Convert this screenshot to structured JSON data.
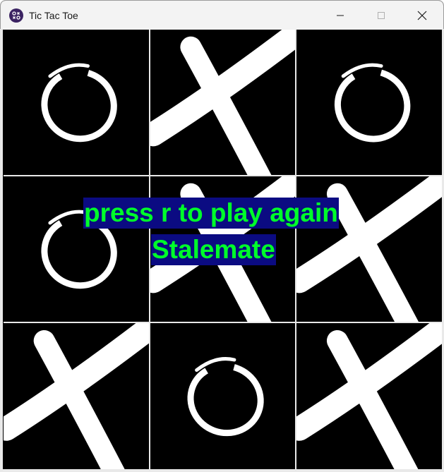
{
  "window": {
    "title": "Tic Tac Toe",
    "icon": "app-icon",
    "controls": [
      "minimize-icon",
      "maximize-icon",
      "close-icon"
    ]
  },
  "board": {
    "cells": [
      "O",
      "X",
      "O",
      "O",
      "X",
      "X",
      "X",
      "O",
      "X"
    ]
  },
  "messages": {
    "restart": "press r to play again",
    "result": "Stalemate"
  },
  "colors": {
    "background": "#000000",
    "marks": "#ffffff",
    "message_text": "#00ff2a",
    "message_bg": "#0b0b82",
    "grid": "#e8e8e8"
  }
}
